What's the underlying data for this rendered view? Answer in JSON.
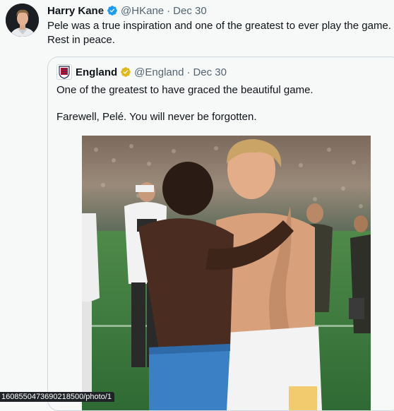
{
  "tweet": {
    "author_name": "Harry Kane",
    "handle": "@HKane",
    "separator": "·",
    "date": "Dec 30",
    "text": "Pele was a true inspiration and one of the greatest to ever play the game. Rest in peace."
  },
  "quote": {
    "author_name": "England",
    "handle": "@England",
    "separator": "·",
    "date": "Dec 30",
    "line1": "One of the greatest to have graced the beautiful game.",
    "line2": "Farewell, Pelé. You will never be forgotten."
  },
  "status_bar": {
    "url": "1608550473690218500/photo/1"
  },
  "icons": {
    "verified": "verified-badge-icon",
    "verified_gold": "verified-gold-badge-icon"
  },
  "colors": {
    "verified_blue": "#1d9bf0",
    "verified_gold": "#e2b719",
    "muted_text": "#536471"
  }
}
